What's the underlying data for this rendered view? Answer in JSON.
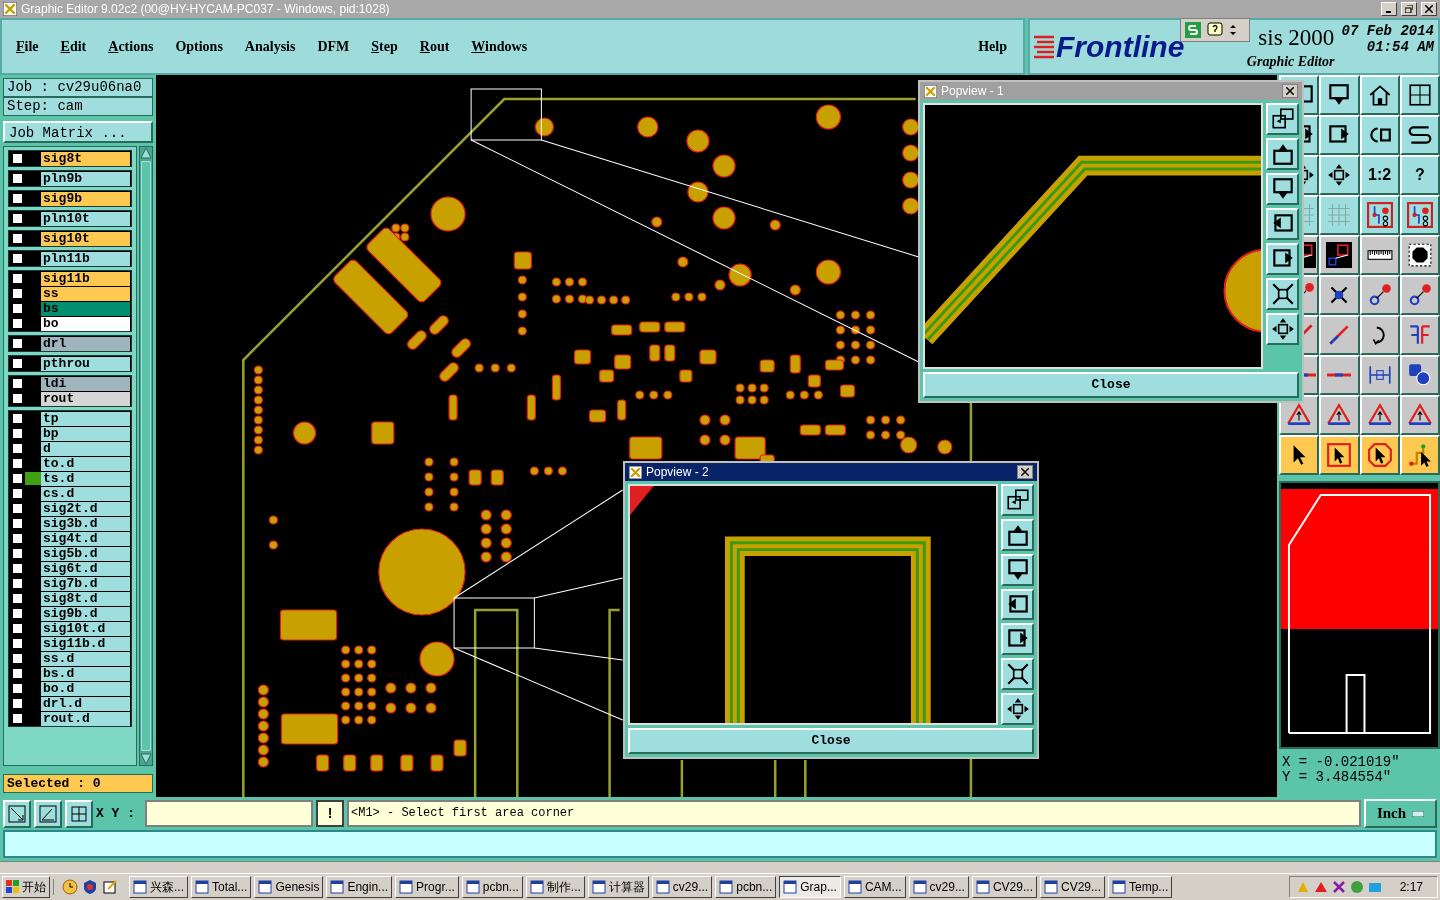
{
  "window": {
    "title": "Graphic Editor 9.02c2 (00@HY-HYCAM-PC037 - Windows, pid:1028)"
  },
  "menu": [
    {
      "label": "File",
      "mnemonic": true
    },
    {
      "label": "Edit",
      "mnemonic": true
    },
    {
      "label": "Actions",
      "mnemonic": true
    },
    {
      "label": "Options",
      "mnemonic": false
    },
    {
      "label": "Analysis",
      "mnemonic": false
    },
    {
      "label": "DFM",
      "mnemonic": false
    },
    {
      "label": "Step",
      "mnemonic": true
    },
    {
      "label": "Rout",
      "mnemonic": true
    },
    {
      "label": "Windows",
      "mnemonic": true
    }
  ],
  "help_menu": {
    "label": "Help"
  },
  "brand": {
    "logo": "Frontline",
    "product": "sis 2000",
    "subtitle": "Graphic Editor",
    "date": "07 Feb 2014",
    "time": "01:54 AM"
  },
  "job": {
    "job": "Job : cv29u06na0",
    "step": "Step: cam",
    "matrix_button": "Job Matrix ..."
  },
  "layer_groups": [
    {
      "layers": [
        {
          "name": "sig8t",
          "color": "#ffc850",
          "checked": false,
          "affected": false
        }
      ]
    },
    {
      "layers": [
        {
          "name": "pln9b",
          "color": "#9edede",
          "checked": false,
          "affected": false
        }
      ]
    },
    {
      "layers": [
        {
          "name": "sig9b",
          "color": "#ffc850",
          "checked": false,
          "affected": false
        }
      ]
    },
    {
      "layers": [
        {
          "name": "pln10t",
          "color": "#9edede",
          "checked": false,
          "affected": false
        }
      ]
    },
    {
      "layers": [
        {
          "name": "sig10t",
          "color": "#ffc850",
          "checked": false,
          "affected": false
        }
      ]
    },
    {
      "layers": [
        {
          "name": "pln11b",
          "color": "#9edede",
          "checked": false,
          "affected": false
        }
      ]
    },
    {
      "layers": [
        {
          "name": "sig11b",
          "color": "#ffc850",
          "checked": false,
          "affected": false
        },
        {
          "name": "ss",
          "color": "#ffc850",
          "checked": false,
          "affected": false
        },
        {
          "name": "bs",
          "color": "#009070",
          "checked": false,
          "affected": false
        },
        {
          "name": "bo",
          "color": "#ffffff",
          "checked": false,
          "affected": false
        }
      ]
    },
    {
      "layers": [
        {
          "name": "drl",
          "color": "#9fb5bd",
          "checked": false,
          "affected": false
        }
      ]
    },
    {
      "layers": [
        {
          "name": "pthrou",
          "color": "#9edede",
          "checked": false,
          "affected": false
        }
      ]
    },
    {
      "layers": [
        {
          "name": "ldi",
          "color": "#9fb5bd",
          "checked": false,
          "affected": false
        },
        {
          "name": "rout",
          "color": "#d6d6d6",
          "checked": false,
          "affected": false
        }
      ]
    },
    {
      "layers": [
        {
          "name": "tp",
          "color": "#9edede",
          "checked": false,
          "affected": false
        },
        {
          "name": "bp",
          "color": "#9edede",
          "checked": false,
          "affected": false
        },
        {
          "name": "d",
          "color": "#9edede",
          "checked": false,
          "affected": false
        },
        {
          "name": "to.d",
          "color": "#9edede",
          "checked": false,
          "affected": false
        },
        {
          "name": "ts.d",
          "color": "#9edede",
          "checked": false,
          "affected": true
        },
        {
          "name": "cs.d",
          "color": "#9edede",
          "checked": false,
          "affected": false
        },
        {
          "name": "sig2t.d",
          "color": "#9edede",
          "checked": false,
          "affected": false
        },
        {
          "name": "sig3b.d",
          "color": "#9edede",
          "checked": false,
          "affected": false
        },
        {
          "name": "sig4t.d",
          "color": "#9edede",
          "checked": false,
          "affected": false
        },
        {
          "name": "sig5b.d",
          "color": "#9edede",
          "checked": false,
          "affected": false
        },
        {
          "name": "sig6t.d",
          "color": "#9edede",
          "checked": false,
          "affected": false
        },
        {
          "name": "sig7b.d",
          "color": "#9edede",
          "checked": false,
          "affected": false
        },
        {
          "name": "sig8t.d",
          "color": "#9edede",
          "checked": false,
          "affected": false
        },
        {
          "name": "sig9b.d",
          "color": "#9edede",
          "checked": false,
          "affected": false
        },
        {
          "name": "sig10t.d",
          "color": "#9edede",
          "checked": false,
          "affected": false
        },
        {
          "name": "sig11b.d",
          "color": "#9edede",
          "checked": false,
          "affected": false
        },
        {
          "name": "ss.d",
          "color": "#9edede",
          "checked": false,
          "affected": false
        },
        {
          "name": "bs.d",
          "color": "#9edede",
          "checked": false,
          "affected": false
        },
        {
          "name": "bo.d",
          "color": "#9edede",
          "checked": false,
          "affected": false
        },
        {
          "name": "drl.d",
          "color": "#9edede",
          "checked": false,
          "affected": false
        },
        {
          "name": "rout.d",
          "color": "#9edede",
          "checked": false,
          "affected": false
        }
      ]
    }
  ],
  "selected_count": "Selected : 0",
  "popviews": [
    {
      "title": "Popview - 1",
      "active": false,
      "close": "Close"
    },
    {
      "title": "Popview - 2",
      "active": true,
      "close": "Close"
    }
  ],
  "toolbar": [
    {
      "kind": "screen-left",
      "color": "#9edede"
    },
    {
      "kind": "screen-down",
      "color": "#9edede"
    },
    {
      "kind": "home",
      "color": "#9edede"
    },
    {
      "kind": "xy-grid",
      "color": "#9edede"
    },
    {
      "kind": "screen-right",
      "color": "#9edede"
    },
    {
      "kind": "screen-right",
      "color": "#9edede"
    },
    {
      "kind": "swap",
      "color": "#9edede"
    },
    {
      "kind": "s-curve",
      "color": "#9edede"
    },
    {
      "kind": "move",
      "color": "#9edede"
    },
    {
      "kind": "move",
      "color": "#9edede"
    },
    {
      "kind": "text",
      "label": "1:2",
      "color": "#9edede"
    },
    {
      "kind": "text",
      "label": "?",
      "color": "#9edede"
    },
    {
      "kind": "grid",
      "color": "#9edede"
    },
    {
      "kind": "grid",
      "color": "#9edede"
    },
    {
      "kind": "net",
      "color": "#9edede"
    },
    {
      "kind": "net",
      "color": "#9edede"
    },
    {
      "kind": "zoom-window",
      "color": "#c8c8c8"
    },
    {
      "kind": "zoom-window",
      "color": "#c8c8c8"
    },
    {
      "kind": "ruler",
      "color": "#c8c8c8"
    },
    {
      "kind": "pad",
      "color": "#c8c8c8"
    },
    {
      "kind": "pad-link",
      "color": "#c8c8c8"
    },
    {
      "kind": "pad-x",
      "color": "#c8c8c8"
    },
    {
      "kind": "pad-link",
      "color": "#c8c8c8"
    },
    {
      "kind": "pad-link",
      "color": "#c8c8c8"
    },
    {
      "kind": "line-diag",
      "color": "#c8c8c8"
    },
    {
      "kind": "line-diag",
      "color": "#c8c8c8"
    },
    {
      "kind": "rotate",
      "color": "#c8c8c8"
    },
    {
      "kind": "mirror",
      "color": "#c8c8c8"
    },
    {
      "kind": "line-red",
      "color": "#c8c8c8"
    },
    {
      "kind": "line-red",
      "color": "#c8c8c8"
    },
    {
      "kind": "measure",
      "color": "#c8c8c8"
    },
    {
      "kind": "shapes",
      "color": "#c8c8c8"
    },
    {
      "kind": "triangle",
      "color": "#c8c8c8"
    },
    {
      "kind": "triangle",
      "color": "#c8c8c8"
    },
    {
      "kind": "triangle",
      "color": "#c8c8c8"
    },
    {
      "kind": "triangle",
      "color": "#c8c8c8"
    },
    {
      "kind": "select",
      "color": "#ffc850"
    },
    {
      "kind": "select-box",
      "color": "#ffc850"
    },
    {
      "kind": "select-poly",
      "color": "#ffc850"
    },
    {
      "kind": "select-net",
      "color": "#ffc850"
    }
  ],
  "coordinates": {
    "x": "X = -0.021019\"",
    "y": "Y = 3.484554\""
  },
  "command": {
    "xy_label": "X Y :",
    "warning": "!",
    "message": "<M1> - Select first area corner",
    "units": "Inch"
  },
  "taskbar": {
    "start": "开始",
    "items": [
      {
        "label": "兴森...",
        "selected": false
      },
      {
        "label": "Total...",
        "selected": false
      },
      {
        "label": "Genesis",
        "selected": false
      },
      {
        "label": "Engin...",
        "selected": false
      },
      {
        "label": "Progr...",
        "selected": false
      },
      {
        "label": "pcbn...",
        "selected": false
      },
      {
        "label": "制作...",
        "selected": false
      },
      {
        "label": "计算器",
        "selected": false
      },
      {
        "label": "cv29...",
        "selected": false
      },
      {
        "label": "pcbn...",
        "selected": false
      },
      {
        "label": "Grap...",
        "selected": true
      },
      {
        "label": "CAM...",
        "selected": false
      },
      {
        "label": "cv29...",
        "selected": false
      },
      {
        "label": "CV29...",
        "selected": false
      },
      {
        "label": "CV29...",
        "selected": false
      },
      {
        "label": "Temp...",
        "selected": false
      }
    ],
    "clock": "2:17"
  }
}
